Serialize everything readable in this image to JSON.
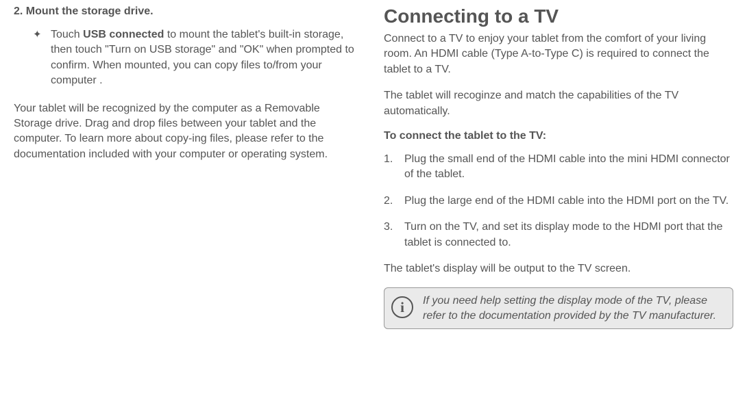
{
  "left": {
    "heading": "2.   Mount the storage drive.",
    "bullet": {
      "pre": "Touch ",
      "bold": "USB connected",
      "post": " to mount the tablet's  built-in storage, then touch \"Turn on USB storage\" and \"OK\" when prompted to confirm. When mounted, you can copy files to/from your computer ."
    },
    "paragraph": "Your tablet will be recognized by the computer as a Removable Storage drive. Drag and drop files between your tablet and the computer. To learn more about copy-ing files, please refer to the documentation included with your computer or operating system."
  },
  "right": {
    "heading": "Connecting to a TV",
    "p1": "Connect to a TV to enjoy your tablet from the comfort of your living room. An HDMI cable (Type A-to-Type C) is required to connect the tablet to a TV.",
    "p2": "The tablet will recoginze and match the capabilities of the TV automatically.",
    "subheading": "To connect the tablet to the TV:",
    "steps": [
      "Plug the small end of the HDMI cable into the mini HDMI connector of the tablet.",
      "Plug the large end of the HDMI cable into the HDMI port on the TV.",
      "Turn on the TV, and set its display mode to the HDMI port that the tablet is connected to."
    ],
    "p3": "The tablet's display will be output to the TV screen.",
    "info": "If you need help setting the display mode of the TV, please refer to the documentation provided by the TV manufacturer."
  }
}
